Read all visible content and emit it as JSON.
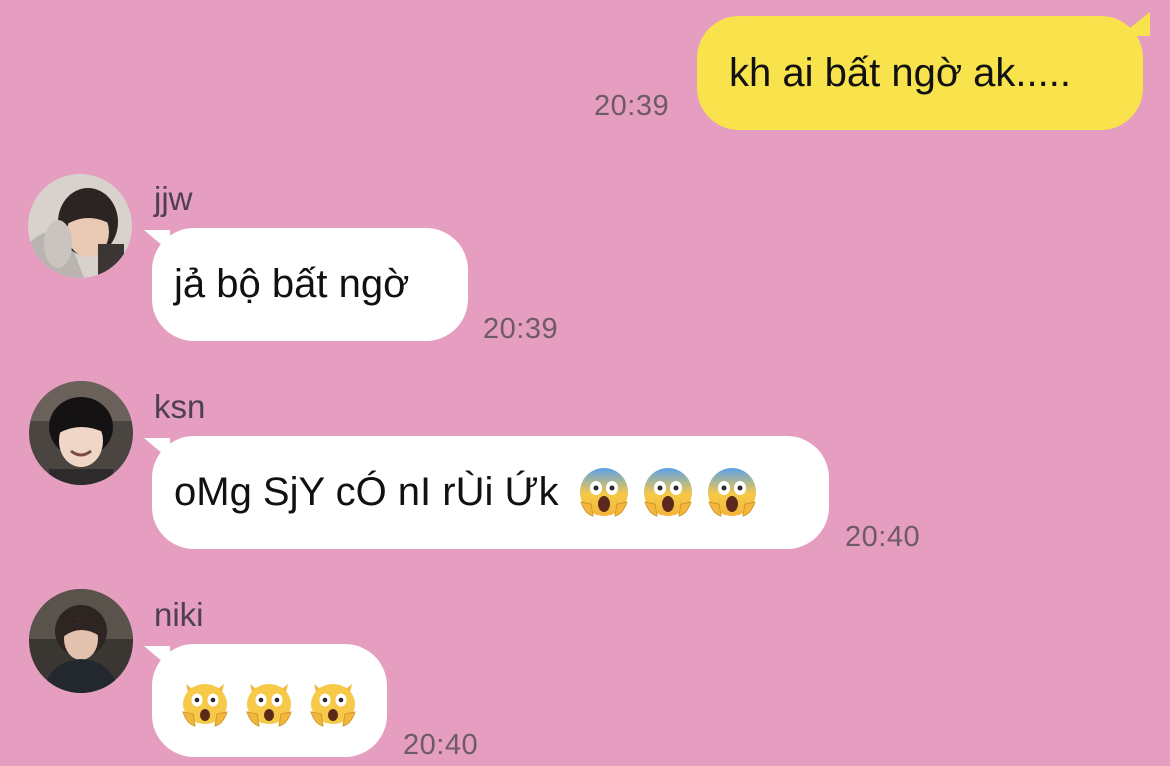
{
  "colors": {
    "background": "#e59dc0",
    "outgoing_bubble": "#f9e34d",
    "incoming_bubble": "#ffffff"
  },
  "outgoing": {
    "text": "kh ai bất ngờ ak.....",
    "time": "20:39"
  },
  "messages": [
    {
      "sender": "jjw",
      "text": "jả bộ bất ngờ",
      "time": "20:39",
      "avatar": "jjw-avatar"
    },
    {
      "sender": "ksn",
      "text": "oMg SjY cÓ nI rÙi Ứk",
      "emojis": [
        "face-screaming-in-fear-icon",
        "face-screaming-in-fear-icon",
        "face-screaming-in-fear-icon"
      ],
      "time": "20:40",
      "avatar": "ksn-avatar"
    },
    {
      "sender": "niki",
      "emojis": [
        "weary-cat-icon",
        "weary-cat-icon",
        "weary-cat-icon"
      ],
      "time": "20:40",
      "avatar": "niki-avatar"
    }
  ]
}
